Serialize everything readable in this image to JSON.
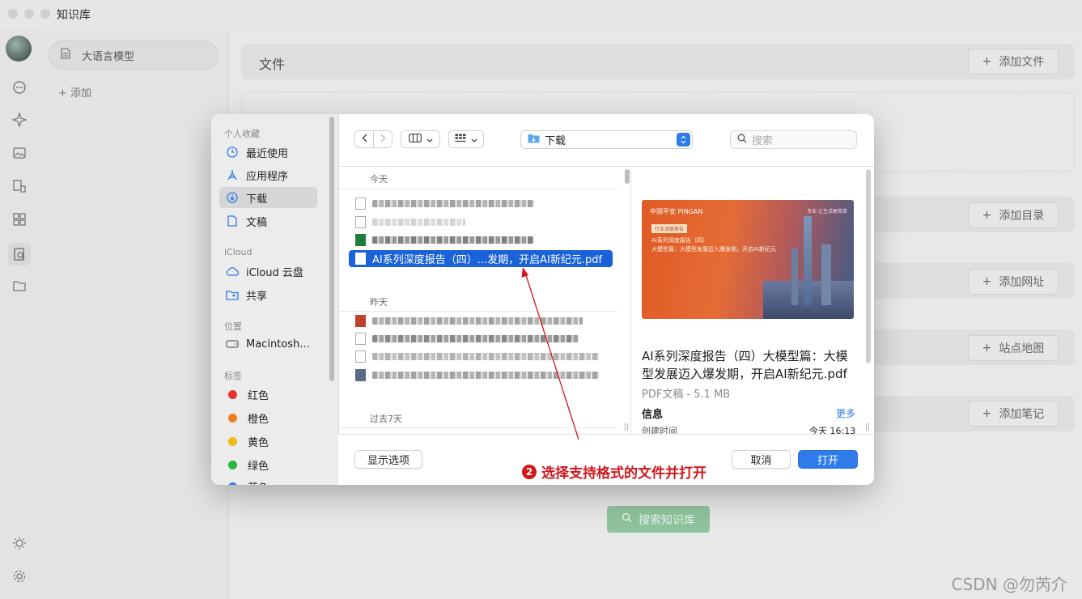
{
  "app": {
    "title": "知识库"
  },
  "knowledge_base": {
    "selected_item": "大语言模型",
    "add_label": "添加",
    "search_button": "搜索知识库"
  },
  "main": {
    "files_title": "文件",
    "buttons": [
      "添加文件",
      "添加目录",
      "添加网址",
      "站点地图",
      "添加笔记"
    ]
  },
  "dialog": {
    "sidebar": {
      "favorites_header": "个人收藏",
      "favorites": [
        "最近使用",
        "应用程序",
        "下载",
        "文稿"
      ],
      "icloud_header": "iCloud",
      "icloud": [
        "iCloud 云盘",
        "共享"
      ],
      "locations_header": "位置",
      "locations": [
        "Macintosh..."
      ],
      "tags_header": "标签",
      "tags": [
        {
          "label": "红色",
          "color": "#e5322d"
        },
        {
          "label": "橙色",
          "color": "#f07d1a"
        },
        {
          "label": "黄色",
          "color": "#f2b814"
        },
        {
          "label": "绿色",
          "color": "#27b83c"
        },
        {
          "label": "蓝色",
          "color": "#2f7bea"
        }
      ]
    },
    "toolbar": {
      "location": "下载",
      "search_placeholder": "搜索"
    },
    "groups": {
      "today": "今天",
      "yesterday": "昨天",
      "past7": "过去7天"
    },
    "selected_file": "AI系列深度报告（四）...发期，开启AI新纪元.pdf",
    "preview": {
      "thumb_brand": "中国平安 PINGAN",
      "thumb_slogan": "专业·让生活更简单",
      "thumb_tag": "行业深度报告",
      "thumb_line1": "AI系列深度报告（四）",
      "thumb_line2": "大模型篇：大模型发展迈入爆发期，开启AI新纪元",
      "title": "AI系列深度报告（四）大模型篇：大模型发展迈入爆发期，开启AI新纪元.pdf",
      "meta": "PDF文稿 - 5.1 MB",
      "info_label": "信息",
      "more_label": "更多",
      "created_label": "创建时间",
      "created_value": "今天 16:13"
    },
    "footer": {
      "options": "显示选项",
      "cancel": "取消",
      "open": "打开"
    }
  },
  "annotation": {
    "number": "2",
    "text": "选择支持格式的文件并打开"
  },
  "watermark": "CSDN @勿芮介"
}
